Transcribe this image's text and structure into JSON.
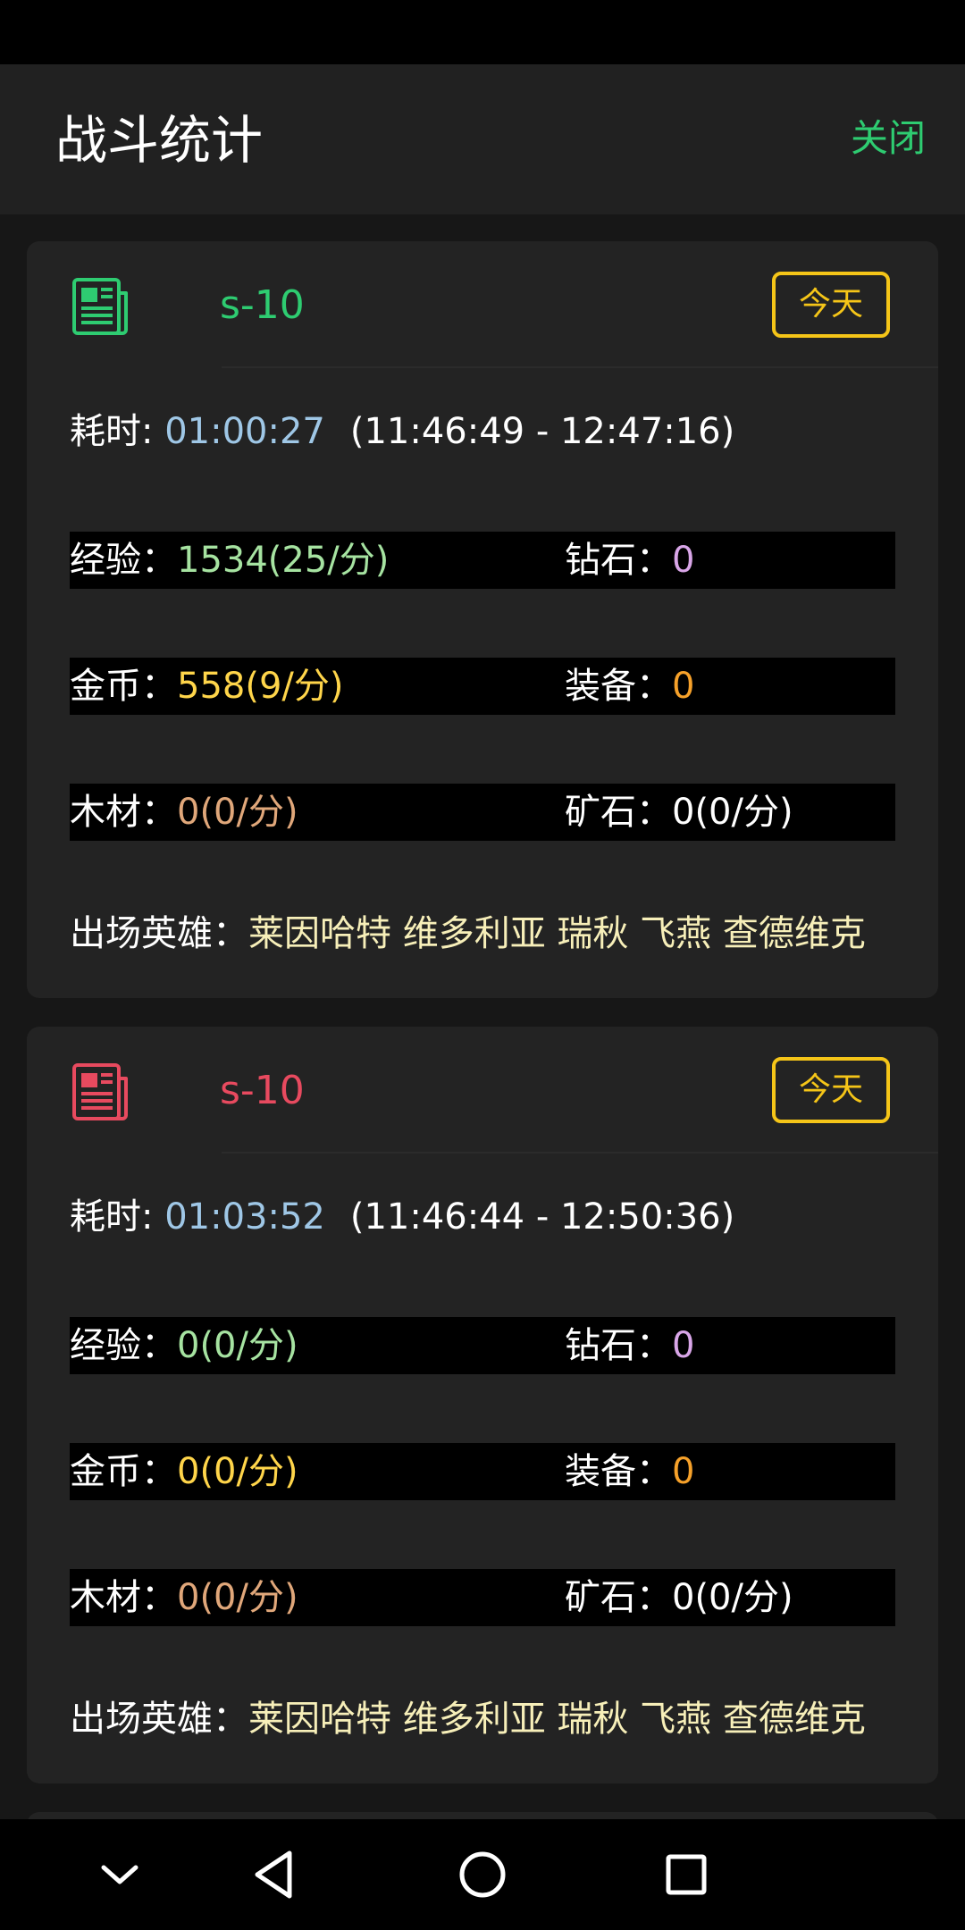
{
  "header": {
    "title": "战斗统计",
    "close_label": "关闭",
    "close_color": "#2ecc71"
  },
  "colors": {
    "accent_yellow": "#f5c518",
    "card_1_accent": "#2ecc71",
    "card_2_accent": "#e84a5f"
  },
  "cards": [
    {
      "icon": "document-icon",
      "id": "s-10",
      "today_label": "今天",
      "time_label": "耗时: ",
      "duration": "01:00:27",
      "range": "(11:46:49 - 12:47:16)",
      "exp_label": "经验：",
      "exp_value": "1534(25/分)",
      "diamond_label": "钻石：",
      "diamond_value": "0",
      "gold_label": "金币：",
      "gold_value": "558(9/分)",
      "equip_label": "装备：",
      "equip_value": "0",
      "wood_label": "木材：",
      "wood_value": "0(0/分)",
      "ore_label": "矿石：",
      "ore_value": "0(0/分)",
      "heroes_label": "出场英雄：",
      "heroes_value": "莱因哈特 维多利亚 瑞秋 飞燕 查德维克"
    },
    {
      "icon": "document-icon",
      "id": "s-10",
      "today_label": "今天",
      "time_label": "耗时: ",
      "duration": "01:03:52",
      "range": "(11:46:44 - 12:50:36)",
      "exp_label": "经验：",
      "exp_value": "0(0/分)",
      "diamond_label": "钻石：",
      "diamond_value": "0",
      "gold_label": "金币：",
      "gold_value": "0(0/分)",
      "equip_label": "装备：",
      "equip_value": "0",
      "wood_label": "木材：",
      "wood_value": "0(0/分)",
      "ore_label": "矿石：",
      "ore_value": "0(0/分)",
      "heroes_label": "出场英雄：",
      "heroes_value": "莱因哈特 维多利亚 瑞秋 飞燕 查德维克"
    }
  ],
  "navbar": {
    "icons": [
      "chevron-down-icon",
      "back-triangle-icon",
      "home-circle-icon",
      "recents-square-icon"
    ]
  }
}
